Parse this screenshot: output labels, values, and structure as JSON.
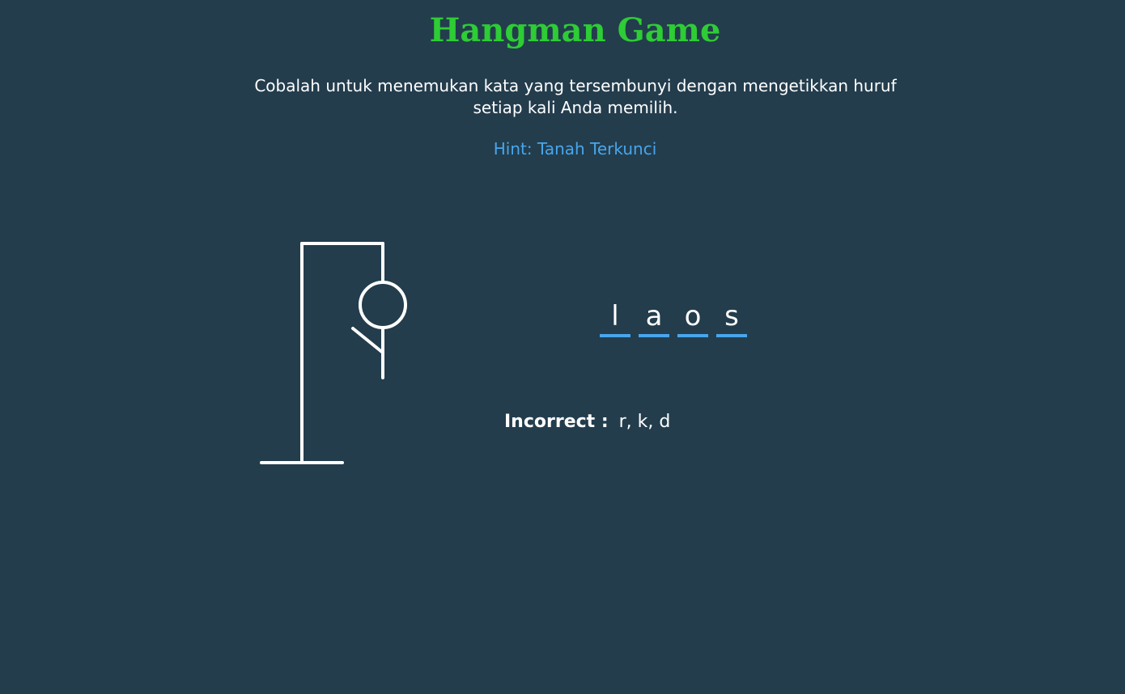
{
  "header": {
    "title": "Hangman Game",
    "instructions": "Cobalah untuk menemukan kata yang tersembunyi dengan mengetikkan huruf setiap kali Anda memilih.",
    "hint": "Hint: Tanah Terkunci"
  },
  "word": {
    "letters": [
      "l",
      "a",
      "o",
      "s"
    ]
  },
  "incorrect": {
    "label": "Incorrect :",
    "letters": "r, k, d"
  },
  "hangman": {
    "parts_shown": [
      "head",
      "body",
      "left-arm"
    ],
    "wrong_guess_count": 3
  },
  "colors": {
    "background": "#233d4d",
    "title": "#2ecc35",
    "hint": "#48a6ec",
    "underline": "#48a6ec",
    "text": "#ffffff"
  }
}
